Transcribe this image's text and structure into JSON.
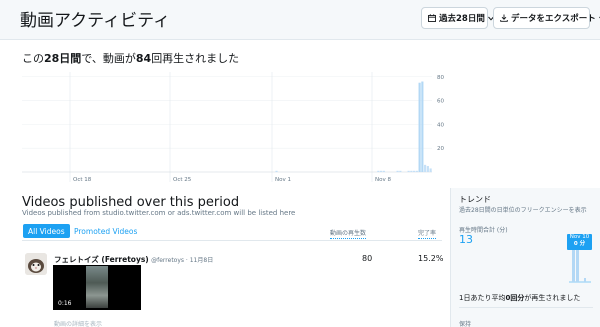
{
  "header": {
    "title": "動画アクティビティ",
    "period_button": "過去28日間",
    "export_button": "データをエクスポート"
  },
  "summary": {
    "prefix": "この",
    "period": "28日間",
    "middle": "で、動画が",
    "count": "84",
    "suffix": "回再生されました"
  },
  "chart_data": {
    "type": "bar",
    "x_tick_labels": [
      "Oct 18",
      "Oct 25",
      "Nov 1",
      "Nov 8"
    ],
    "y_tick_labels": [
      "20",
      "40",
      "60",
      "80"
    ],
    "ylim": [
      0,
      84
    ],
    "grid": true,
    "highlight_color": "#b3d8f5",
    "bar_color": "#c5e0f7",
    "values": [
      0,
      0,
      0,
      0,
      0,
      0,
      0,
      0,
      0,
      0,
      0,
      0,
      0,
      0,
      0,
      0,
      0,
      0,
      0,
      0,
      0,
      0,
      0,
      0,
      0,
      0,
      0,
      0,
      0,
      0,
      0,
      0,
      0,
      0,
      0,
      0,
      0,
      0,
      0,
      0,
      0,
      0,
      0,
      0,
      0,
      0,
      0,
      0,
      0,
      0,
      0,
      0,
      0,
      0,
      0,
      0,
      0,
      0,
      0,
      0,
      0,
      0,
      0,
      0,
      0,
      0,
      0,
      0,
      0,
      0,
      0,
      0,
      0,
      0,
      0,
      0,
      0,
      0,
      0,
      0,
      0,
      0,
      0,
      0,
      0,
      0,
      0,
      0,
      0,
      0,
      0,
      0,
      1,
      0,
      0,
      0,
      0,
      0,
      0,
      0,
      0,
      0,
      0,
      0,
      0,
      0,
      0,
      0,
      0,
      0,
      0,
      0,
      0,
      0,
      0,
      0,
      0,
      0,
      0,
      0,
      0,
      0,
      0,
      0,
      0,
      0,
      0,
      0,
      0,
      1,
      1,
      1,
      0,
      0,
      0,
      0,
      1,
      1,
      0,
      0,
      1,
      1,
      1,
      1,
      75,
      76,
      6,
      5,
      3
    ]
  },
  "videos_section": {
    "title": "Videos published over this period",
    "subtitle": "Videos published from studio.twitter.com or ads.twitter.com will be listed here",
    "tabs": [
      "All Videos",
      "Promoted Videos"
    ],
    "col_views": "動画の再生数",
    "col_rate": "完了率",
    "rows": [
      {
        "name": "フェレトイズ (Ferretoys)",
        "meta": "@ferretoys · 11月8日",
        "views": "80",
        "rate": "15.2%",
        "duration": "0:16",
        "detail_link": "動画の詳細を表示"
      }
    ]
  },
  "trend": {
    "title": "トレンド",
    "subtitle": "過去28日間の日単位のフリークエンシーを表示",
    "label": "再生時間合計 (分)",
    "value": "13",
    "tooltip_date": "Nov 10",
    "tooltip_value": "0 分",
    "daily_prefix": "1日あたり平均",
    "daily_value": "0回分",
    "daily_suffix": "が再生されました",
    "retention_label": "保持"
  },
  "colors": {
    "accent": "#1da1f2",
    "header_bg": "#f5f8fa"
  }
}
